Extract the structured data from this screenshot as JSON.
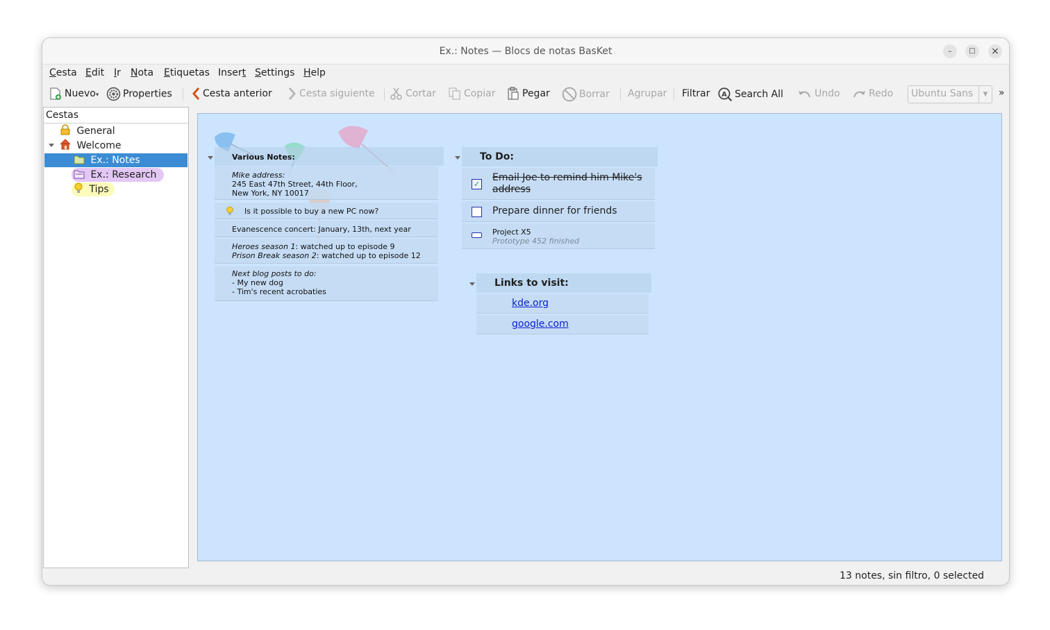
{
  "window": {
    "title": "Ex.: Notes — Blocs de notas BasKet",
    "controls": {
      "minimize": "–",
      "maximize": "□",
      "close": "×"
    }
  },
  "menubar": {
    "items": [
      {
        "first": "C",
        "rest": "esta"
      },
      {
        "first": "E",
        "rest": "dit"
      },
      {
        "first": "I",
        "rest": "r"
      },
      {
        "first": "N",
        "rest": "ota"
      },
      {
        "first": "E",
        "rest": "tiquetas"
      },
      {
        "first": "Inser",
        "rest": "t",
        "underline_last": true
      },
      {
        "first": "S",
        "rest": "ettings"
      },
      {
        "first": "H",
        "rest": "elp"
      }
    ]
  },
  "toolbar": {
    "new": "Nuevo",
    "properties": "Properties",
    "prev": "Cesta anterior",
    "next": "Cesta siguiente",
    "cut": "Cortar",
    "copy": "Copiar",
    "paste": "Pegar",
    "delete": "Borrar",
    "group": "Agrupar",
    "filter": "Filtrar",
    "search_all": "Search All",
    "undo": "Undo",
    "redo": "Redo",
    "font": "Ubuntu Sans",
    "overflow": "»"
  },
  "sidebar": {
    "title": "Cestas",
    "items": [
      {
        "label": "General",
        "icon": "lock-icon"
      },
      {
        "label": "Welcome",
        "icon": "home-icon"
      },
      {
        "label": "Ex.: Notes",
        "icon": "folder-icon",
        "selected": true
      },
      {
        "label": "Ex.: Research",
        "icon": "folder-icon",
        "color": "#e3c7f4"
      },
      {
        "label": "Tips",
        "icon": "lightbulb-icon",
        "color": "#fcfbb9"
      }
    ]
  },
  "basket": {
    "various": {
      "title": "Various Notes:",
      "mike_label": "Mike address:",
      "mike_line1": "245 East 47th Street, 44th Floor,",
      "mike_line2": "New York, NY 10017",
      "pc": "Is it possible to buy a new PC now?",
      "concert": "Evanescence concert: January, 13th, next year",
      "heroes_title": "Heroes season 1",
      "heroes_rest": ": watched up to episode 9",
      "prison_title": "Prison Break season 2",
      "prison_rest": ": watched up to episode 12",
      "blog_title": "Next blog posts to do:",
      "blog1": "- My new dog",
      "blog2": "- Tim's recent acrobaties"
    },
    "todo": {
      "title": "To Do:",
      "item1": "Email Joe to remind him Mike's",
      "item1b": "address",
      "item2": "Prepare dinner for friends",
      "item3": "Project X5",
      "item3_sub": "Prototype 452 finished"
    },
    "links": {
      "title": "Links to visit:",
      "link1": "kde.org",
      "link2": "google.com"
    }
  },
  "status": {
    "text": "13 notes, sin filtro, 0 selected"
  },
  "colors": {
    "content_bg": "#cce4fd",
    "selection": "#3b8cd4",
    "research_tag": "#e3c7f4",
    "tips_tag": "#fcfbb9"
  }
}
